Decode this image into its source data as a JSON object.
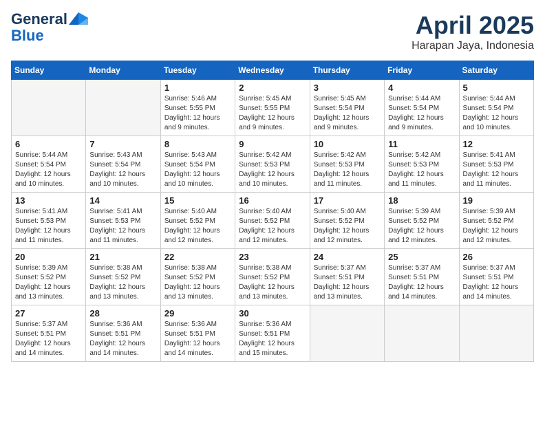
{
  "header": {
    "logo_line1": "General",
    "logo_line2": "Blue",
    "title": "April 2025",
    "subtitle": "Harapan Jaya, Indonesia"
  },
  "calendar": {
    "days_of_week": [
      "Sunday",
      "Monday",
      "Tuesday",
      "Wednesday",
      "Thursday",
      "Friday",
      "Saturday"
    ],
    "weeks": [
      [
        {
          "day": "",
          "sunrise": "",
          "sunset": "",
          "daylight": "",
          "empty": true
        },
        {
          "day": "",
          "sunrise": "",
          "sunset": "",
          "daylight": "",
          "empty": true
        },
        {
          "day": "1",
          "sunrise": "Sunrise: 5:46 AM",
          "sunset": "Sunset: 5:55 PM",
          "daylight": "Daylight: 12 hours and 9 minutes."
        },
        {
          "day": "2",
          "sunrise": "Sunrise: 5:45 AM",
          "sunset": "Sunset: 5:55 PM",
          "daylight": "Daylight: 12 hours and 9 minutes."
        },
        {
          "day": "3",
          "sunrise": "Sunrise: 5:45 AM",
          "sunset": "Sunset: 5:54 PM",
          "daylight": "Daylight: 12 hours and 9 minutes."
        },
        {
          "day": "4",
          "sunrise": "Sunrise: 5:44 AM",
          "sunset": "Sunset: 5:54 PM",
          "daylight": "Daylight: 12 hours and 9 minutes."
        },
        {
          "day": "5",
          "sunrise": "Sunrise: 5:44 AM",
          "sunset": "Sunset: 5:54 PM",
          "daylight": "Daylight: 12 hours and 10 minutes."
        }
      ],
      [
        {
          "day": "6",
          "sunrise": "Sunrise: 5:44 AM",
          "sunset": "Sunset: 5:54 PM",
          "daylight": "Daylight: 12 hours and 10 minutes."
        },
        {
          "day": "7",
          "sunrise": "Sunrise: 5:43 AM",
          "sunset": "Sunset: 5:54 PM",
          "daylight": "Daylight: 12 hours and 10 minutes."
        },
        {
          "day": "8",
          "sunrise": "Sunrise: 5:43 AM",
          "sunset": "Sunset: 5:54 PM",
          "daylight": "Daylight: 12 hours and 10 minutes."
        },
        {
          "day": "9",
          "sunrise": "Sunrise: 5:42 AM",
          "sunset": "Sunset: 5:53 PM",
          "daylight": "Daylight: 12 hours and 10 minutes."
        },
        {
          "day": "10",
          "sunrise": "Sunrise: 5:42 AM",
          "sunset": "Sunset: 5:53 PM",
          "daylight": "Daylight: 12 hours and 11 minutes."
        },
        {
          "day": "11",
          "sunrise": "Sunrise: 5:42 AM",
          "sunset": "Sunset: 5:53 PM",
          "daylight": "Daylight: 12 hours and 11 minutes."
        },
        {
          "day": "12",
          "sunrise": "Sunrise: 5:41 AM",
          "sunset": "Sunset: 5:53 PM",
          "daylight": "Daylight: 12 hours and 11 minutes."
        }
      ],
      [
        {
          "day": "13",
          "sunrise": "Sunrise: 5:41 AM",
          "sunset": "Sunset: 5:53 PM",
          "daylight": "Daylight: 12 hours and 11 minutes."
        },
        {
          "day": "14",
          "sunrise": "Sunrise: 5:41 AM",
          "sunset": "Sunset: 5:53 PM",
          "daylight": "Daylight: 12 hours and 11 minutes."
        },
        {
          "day": "15",
          "sunrise": "Sunrise: 5:40 AM",
          "sunset": "Sunset: 5:52 PM",
          "daylight": "Daylight: 12 hours and 12 minutes."
        },
        {
          "day": "16",
          "sunrise": "Sunrise: 5:40 AM",
          "sunset": "Sunset: 5:52 PM",
          "daylight": "Daylight: 12 hours and 12 minutes."
        },
        {
          "day": "17",
          "sunrise": "Sunrise: 5:40 AM",
          "sunset": "Sunset: 5:52 PM",
          "daylight": "Daylight: 12 hours and 12 minutes."
        },
        {
          "day": "18",
          "sunrise": "Sunrise: 5:39 AM",
          "sunset": "Sunset: 5:52 PM",
          "daylight": "Daylight: 12 hours and 12 minutes."
        },
        {
          "day": "19",
          "sunrise": "Sunrise: 5:39 AM",
          "sunset": "Sunset: 5:52 PM",
          "daylight": "Daylight: 12 hours and 12 minutes."
        }
      ],
      [
        {
          "day": "20",
          "sunrise": "Sunrise: 5:39 AM",
          "sunset": "Sunset: 5:52 PM",
          "daylight": "Daylight: 12 hours and 13 minutes."
        },
        {
          "day": "21",
          "sunrise": "Sunrise: 5:38 AM",
          "sunset": "Sunset: 5:52 PM",
          "daylight": "Daylight: 12 hours and 13 minutes."
        },
        {
          "day": "22",
          "sunrise": "Sunrise: 5:38 AM",
          "sunset": "Sunset: 5:52 PM",
          "daylight": "Daylight: 12 hours and 13 minutes."
        },
        {
          "day": "23",
          "sunrise": "Sunrise: 5:38 AM",
          "sunset": "Sunset: 5:52 PM",
          "daylight": "Daylight: 12 hours and 13 minutes."
        },
        {
          "day": "24",
          "sunrise": "Sunrise: 5:37 AM",
          "sunset": "Sunset: 5:51 PM",
          "daylight": "Daylight: 12 hours and 13 minutes."
        },
        {
          "day": "25",
          "sunrise": "Sunrise: 5:37 AM",
          "sunset": "Sunset: 5:51 PM",
          "daylight": "Daylight: 12 hours and 14 minutes."
        },
        {
          "day": "26",
          "sunrise": "Sunrise: 5:37 AM",
          "sunset": "Sunset: 5:51 PM",
          "daylight": "Daylight: 12 hours and 14 minutes."
        }
      ],
      [
        {
          "day": "27",
          "sunrise": "Sunrise: 5:37 AM",
          "sunset": "Sunset: 5:51 PM",
          "daylight": "Daylight: 12 hours and 14 minutes."
        },
        {
          "day": "28",
          "sunrise": "Sunrise: 5:36 AM",
          "sunset": "Sunset: 5:51 PM",
          "daylight": "Daylight: 12 hours and 14 minutes."
        },
        {
          "day": "29",
          "sunrise": "Sunrise: 5:36 AM",
          "sunset": "Sunset: 5:51 PM",
          "daylight": "Daylight: 12 hours and 14 minutes."
        },
        {
          "day": "30",
          "sunrise": "Sunrise: 5:36 AM",
          "sunset": "Sunset: 5:51 PM",
          "daylight": "Daylight: 12 hours and 15 minutes."
        },
        {
          "day": "",
          "sunrise": "",
          "sunset": "",
          "daylight": "",
          "empty": true
        },
        {
          "day": "",
          "sunrise": "",
          "sunset": "",
          "daylight": "",
          "empty": true
        },
        {
          "day": "",
          "sunrise": "",
          "sunset": "",
          "daylight": "",
          "empty": true
        }
      ]
    ]
  }
}
